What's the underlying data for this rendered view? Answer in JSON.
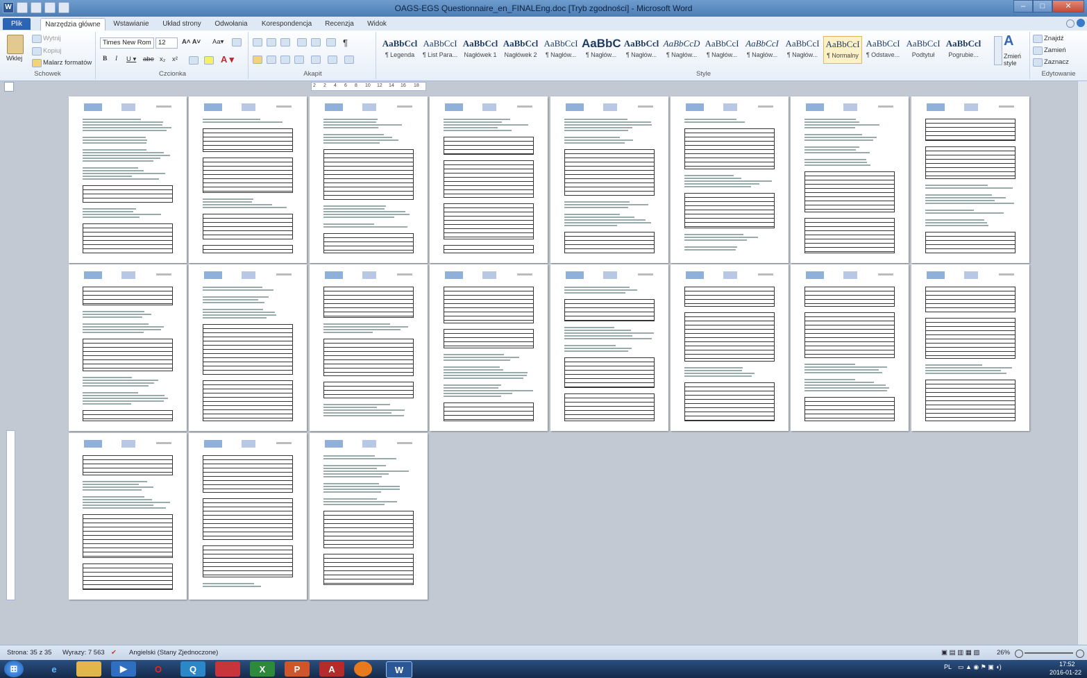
{
  "window": {
    "title": "OAGS-EGS Questionnaire_en_FINALEng.doc [Tryb zgodności] - Microsoft Word"
  },
  "tabs": [
    "Plik",
    "Narzędzia główne",
    "Wstawianie",
    "Układ strony",
    "Odwołania",
    "Korespondencja",
    "Recenzja",
    "Widok"
  ],
  "ribbon": {
    "clipboard": {
      "paste": "Wklej",
      "cut": "Wytnij",
      "copy": "Kopiuj",
      "painter": "Malarz formatów",
      "label": "Schowek"
    },
    "font": {
      "name": "Times New Rom",
      "size": "12",
      "label": "Czcionka"
    },
    "paragraph": {
      "label": "Akapit"
    },
    "styles": {
      "label": "Style",
      "items": [
        {
          "sample": "AaBbCcl",
          "name": "¶ Legenda"
        },
        {
          "sample": "AaBbCcI",
          "name": "¶ List Para..."
        },
        {
          "sample": "AaBbCcl",
          "name": "Nagłówek 1"
        },
        {
          "sample": "AaBbCcl",
          "name": "Nagłówek 2"
        },
        {
          "sample": "AaBbCcI",
          "name": "¶ Nagłów..."
        },
        {
          "sample": "AaBbC",
          "name": "¶ Nagłów..."
        },
        {
          "sample": "AaBbCcl",
          "name": "¶ Nagłów..."
        },
        {
          "sample": "AaBbCcD",
          "name": "¶ Nagłów..."
        },
        {
          "sample": "AaBbCcI",
          "name": "¶ Nagłów..."
        },
        {
          "sample": "AaBbCcI",
          "name": "¶ Nagłów..."
        },
        {
          "sample": "AaBbCcI",
          "name": "¶ Nagłów..."
        },
        {
          "sample": "AaBbCcI",
          "name": "¶ Normalny"
        },
        {
          "sample": "AaBbCcI",
          "name": "¶ Odstave..."
        },
        {
          "sample": "AaBbCcI",
          "name": "Podtytuł"
        },
        {
          "sample": "AaBbCcl",
          "name": "Pogrubie..."
        }
      ],
      "change": "Zmień style"
    },
    "editing": {
      "find": "Znajdź",
      "replace": "Zamień",
      "select": "Zaznacz",
      "label": "Edytowanie"
    }
  },
  "ruler": {
    "ticks": [
      "2",
      "2",
      "4",
      "6",
      "8",
      "10",
      "12",
      "14",
      "16",
      "18"
    ]
  },
  "status": {
    "page": "Strona: 35 z 35",
    "words": "Wyrazy: 7 563",
    "lang": "Angielski (Stany Zjednoczone)",
    "zoom": "26%"
  },
  "tray": {
    "lang": "PL",
    "time": "17:52",
    "date": "2016-01-22"
  },
  "colors": {
    "word_blue": "#2b5797",
    "ribbon_bg": "#e6eef8",
    "file_tab": "#2b63b5"
  }
}
